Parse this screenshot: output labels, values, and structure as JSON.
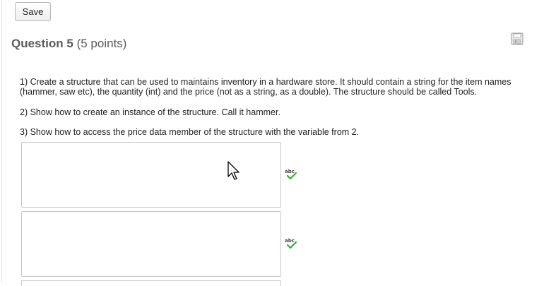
{
  "toolbar": {
    "save_label": "Save"
  },
  "question": {
    "number_label": "Question 5",
    "points_label": "(5 points)",
    "paragraphs": [
      "1) Create a structure that can be used to maintains inventory in a hardware store. It should contain a string for the item names (hammer, saw etc), the quantity (int) and the price (not as a string, as a double). The structure should be called Tools.",
      "2) Show how to create an instance of the structure. Call it hammer.",
      "3) Show how to access the price data member of the structure with the variable from 2."
    ]
  },
  "answers": [
    {
      "value": ""
    },
    {
      "value": ""
    }
  ],
  "icons": {
    "save": "floppy-disk-icon",
    "spellcheck": "spellcheck-icon",
    "cursor": "mouse-pointer-icon"
  },
  "colors": {
    "title": "#5a5a5a",
    "spell_check_green": "#3aa83a"
  }
}
